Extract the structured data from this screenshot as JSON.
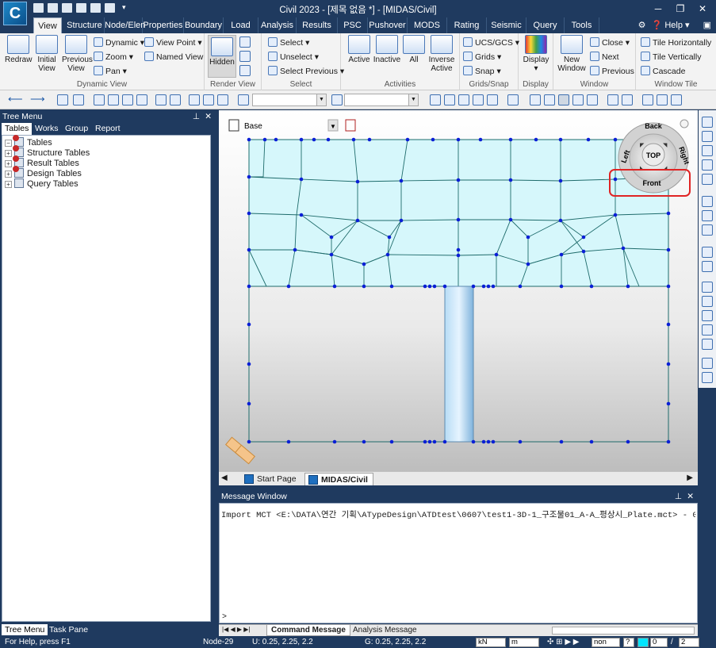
{
  "title": {
    "window_title": "Civil 2023 - [제목 없음 *] - [MIDAS/Civil]",
    "app_logo": "C"
  },
  "menu": {
    "tabs": [
      "View",
      "Structure",
      "Node/Elen",
      "Properties",
      "Boundary",
      "Load",
      "Analysis",
      "Results",
      "PSC",
      "Pushover",
      "MODS",
      "Rating",
      "Seismic Pe",
      "Query",
      "Tools"
    ],
    "active": "View",
    "help": "Help"
  },
  "ribbon": {
    "redraw": "Redraw",
    "initial_view": "Initial View",
    "previous_view": "Previous View",
    "dynamic": "Dynamic",
    "zoom": "Zoom",
    "pan": "Pan",
    "view_point": "View Point",
    "named_view": "Named View",
    "group_dynamic_view": "Dynamic View",
    "hidden": "Hidden",
    "group_render_view": "Render View",
    "select": "Select",
    "unselect": "Unselect",
    "select_previous": "Select Previous",
    "group_select": "Select",
    "active": "Active",
    "inactive": "Inactive",
    "all": "All",
    "inverse_active": "Inverse Active",
    "group_activities": "Activities",
    "ucs_gcs": "UCS/GCS",
    "grids": "Grids",
    "snap": "Snap",
    "group_grids_snap": "Grids/Snap",
    "display": "Display",
    "group_display": "Display",
    "new_window": "New Window",
    "close": "Close",
    "next": "Next",
    "previous": "Previous",
    "group_window": "Window",
    "tile_horizontally": "Tile Horizontally",
    "tile_vertically": "Tile Vertically",
    "cascade": "Cascade",
    "group_window_tile": "Window Tile"
  },
  "tree": {
    "header": "Tree Menu",
    "tabs": [
      "Tables",
      "Works",
      "Group",
      "Report"
    ],
    "active_tab": "Tables",
    "root": "Tables",
    "items": [
      "Structure Tables",
      "Result Tables",
      "Design Tables",
      "Query Tables"
    ],
    "bottom_tabs": [
      "Tree Menu",
      "Task Pane"
    ]
  },
  "viewport": {
    "layer_combo": "Base",
    "view_cube": {
      "back": "Back",
      "left": "Left",
      "right": "Right",
      "top": "TOP",
      "front": "Front"
    },
    "highlight_color": "#e02424",
    "mesh_fill": "#d6f7fb",
    "node_color": "#0a1fd6"
  },
  "doc_tabs": {
    "tabs": [
      "Start Page",
      "MIDAS/Civil"
    ],
    "active": "MIDAS/Civil"
  },
  "message": {
    "header": "Message Window",
    "text": "Import MCT <E:\\DATA\\연간 기획\\ATypeDesign\\ATDtest\\0607\\test1-3D-1_구조물01_A-A_평상시_Plate.mct> - 0 erro",
    "prompt": ">",
    "tabs": [
      "Command Message",
      "Analysis Message"
    ],
    "active_tab": "Command Message"
  },
  "status": {
    "help": "For Help, press F1",
    "node": "Node-29",
    "u": "U: 0.25, 2.25, 2.2",
    "g": "G: 0.25, 2.25, 2.2",
    "force_unit": "kN",
    "length_unit": "m",
    "mode": "non",
    "page_value": "0",
    "page_total": "2"
  }
}
